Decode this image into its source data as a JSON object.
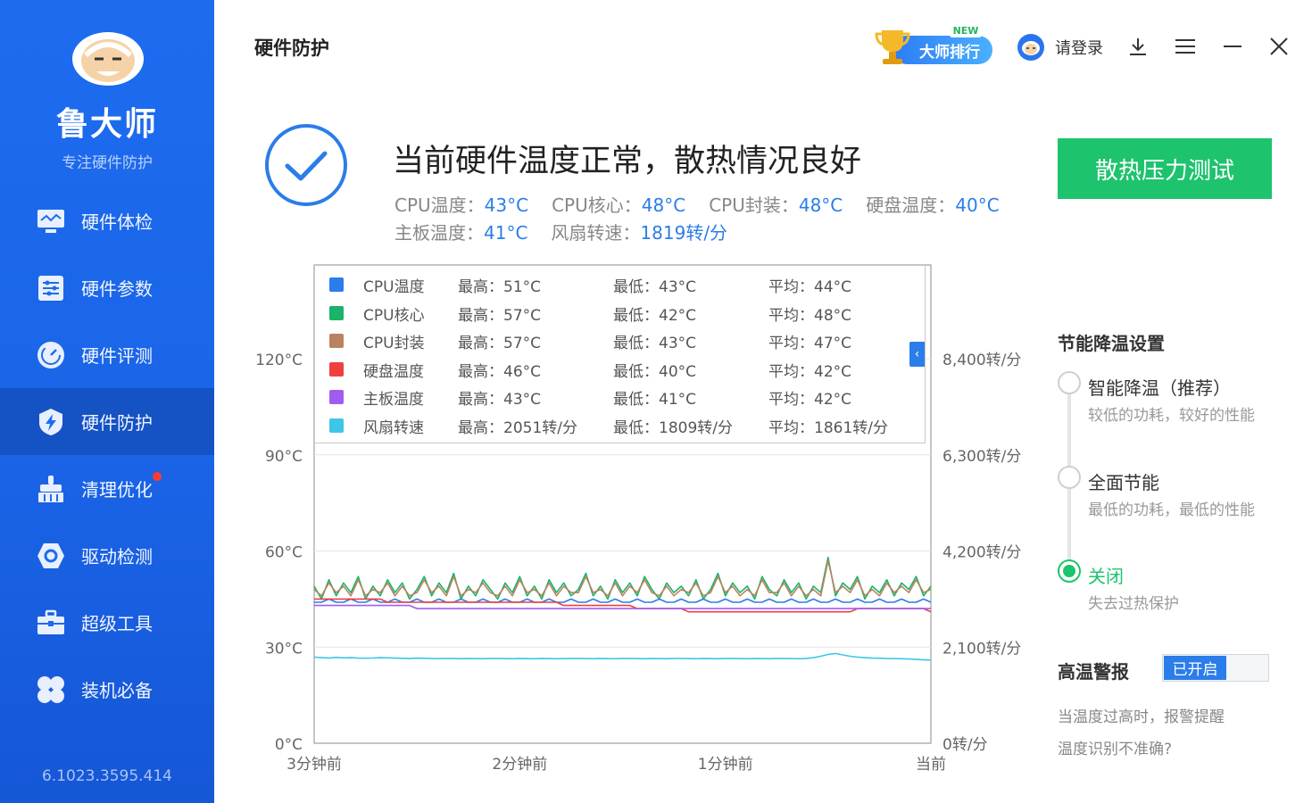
{
  "sidebar": {
    "app_name": "鲁大师",
    "slogan": "专注硬件防护",
    "version": "6.1023.3595.414",
    "items": [
      {
        "label": "硬件体检",
        "icon": "monitor-icon"
      },
      {
        "label": "硬件参数",
        "icon": "sliders-icon"
      },
      {
        "label": "硬件评测",
        "icon": "gauge-icon"
      },
      {
        "label": "硬件防护",
        "icon": "shield-bolt-icon",
        "active": true
      },
      {
        "label": "清理优化",
        "icon": "broom-icon",
        "badge": "red-dot"
      },
      {
        "label": "驱动检测",
        "icon": "hexagon-nut-icon"
      },
      {
        "label": "超级工具",
        "icon": "toolbox-icon"
      },
      {
        "label": "装机必备",
        "icon": "petals-icon"
      }
    ]
  },
  "header": {
    "title": "硬件防护",
    "rank_label": "大师排行",
    "new_tag": "NEW",
    "login_label": "请登录"
  },
  "status": {
    "headline": "当前硬件温度正常，散热情况良好",
    "metrics_row1": [
      {
        "label": "CPU温度：",
        "value": "43°C"
      },
      {
        "label": "CPU核心：",
        "value": "48°C"
      },
      {
        "label": "CPU封装：",
        "value": "48°C"
      },
      {
        "label": "硬盘温度：",
        "value": "40°C"
      }
    ],
    "metrics_row2": [
      {
        "label": "主板温度：",
        "value": "41°C"
      },
      {
        "label": "风扇转速：",
        "value": "1819转/分"
      }
    ],
    "stress_button": "散热压力测试"
  },
  "legend": [
    {
      "name": "CPU温度",
      "max": "最高：51°C",
      "min": "最低：43°C",
      "avg": "平均：44°C",
      "color": "#2b7de9"
    },
    {
      "name": "CPU核心",
      "max": "最高：57°C",
      "min": "最低：42°C",
      "avg": "平均：48°C",
      "color": "#1ab36a"
    },
    {
      "name": "CPU封装",
      "max": "最高：57°C",
      "min": "最低：43°C",
      "avg": "平均：47°C",
      "color": "#b9835f"
    },
    {
      "name": "硬盘温度",
      "max": "最高：46°C",
      "min": "最低：40°C",
      "avg": "平均：42°C",
      "color": "#ef3f3f"
    },
    {
      "name": "主板温度",
      "max": "最高：43°C",
      "min": "最低：41°C",
      "avg": "平均：42°C",
      "color": "#a05cf0"
    },
    {
      "name": "风扇转速",
      "max": "最高：2051转/分",
      "min": "最低：1809转/分",
      "avg": "平均：1861转/分",
      "color": "#3dc6e6"
    }
  ],
  "chart_data": {
    "type": "line",
    "x_tick_labels": [
      "3分钟前",
      "2分钟前",
      "1分钟前",
      "当前"
    ],
    "y_left_ticks": [
      "0°C",
      "30°C",
      "60°C",
      "90°C",
      "120°C"
    ],
    "y_right_ticks": [
      "0转/分",
      "2,100转/分",
      "4,200转/分",
      "6,300转/分",
      "8,400转/分"
    ],
    "y_left_range": [
      0,
      120
    ],
    "y_right_range": [
      0,
      8400
    ],
    "grid": true,
    "series": [
      {
        "name": "CPU核心",
        "axis": "left",
        "color": "#1ab36a",
        "values": [
          49,
          45,
          51,
          46,
          50,
          47,
          52,
          45,
          49,
          46,
          51,
          47,
          50,
          45,
          48,
          52,
          46,
          50,
          47,
          53,
          45,
          49,
          46,
          51,
          48,
          45,
          50,
          47,
          52,
          46,
          49,
          45,
          51,
          47,
          50,
          46,
          48,
          53,
          46,
          49,
          45,
          51,
          47,
          50,
          46,
          52,
          48,
          45,
          50,
          47,
          49,
          46,
          51,
          45,
          48,
          53,
          46,
          50,
          47,
          49,
          45,
          52,
          48,
          46,
          51,
          47,
          50,
          45,
          49,
          47,
          58,
          46,
          50,
          48,
          52,
          45,
          49,
          47,
          51,
          46,
          50,
          48,
          52,
          46,
          49
        ]
      },
      {
        "name": "CPU封装",
        "axis": "left",
        "color": "#b9835f",
        "values": [
          48,
          46,
          50,
          47,
          49,
          46,
          51,
          46,
          48,
          47,
          50,
          46,
          49,
          46,
          47,
          51,
          47,
          49,
          46,
          52,
          46,
          48,
          47,
          50,
          47,
          46,
          49,
          46,
          51,
          47,
          48,
          46,
          50,
          46,
          49,
          47,
          47,
          52,
          47,
          48,
          46,
          50,
          46,
          49,
          47,
          51,
          47,
          46,
          49,
          46,
          48,
          47,
          50,
          46,
          47,
          52,
          47,
          49,
          46,
          48,
          46,
          51,
          47,
          47,
          50,
          46,
          49,
          46,
          48,
          46,
          57,
          47,
          49,
          47,
          51,
          46,
          48,
          46,
          50,
          47,
          49,
          47,
          51,
          47,
          48
        ]
      },
      {
        "name": "CPU温度",
        "axis": "left",
        "color": "#2b7de9",
        "values": [
          44,
          44,
          45,
          44,
          44,
          45,
          44,
          44,
          45,
          44,
          44,
          45,
          44,
          44,
          45,
          44,
          44,
          45,
          44,
          44,
          45,
          44,
          44,
          45,
          44,
          44,
          45,
          44,
          44,
          45,
          44,
          44,
          45,
          44,
          44,
          45,
          44,
          44,
          45,
          44,
          44,
          45,
          44,
          44,
          45,
          44,
          44,
          45,
          44,
          44,
          45,
          44,
          44,
          45,
          44,
          44,
          45,
          44,
          44,
          45,
          44,
          44,
          45,
          44,
          44,
          45,
          44,
          44,
          45,
          44,
          44,
          45,
          44,
          44,
          45,
          44,
          44,
          45,
          44,
          44,
          45,
          44,
          44,
          45,
          44
        ]
      },
      {
        "name": "硬盘温度",
        "axis": "left",
        "color": "#ef3f3f",
        "values": [
          45,
          45,
          45,
          45,
          45,
          45,
          45,
          45,
          45,
          45,
          44,
          44,
          44,
          44,
          44,
          44,
          44,
          44,
          44,
          44,
          44,
          44,
          44,
          44,
          44,
          44,
          44,
          44,
          44,
          44,
          44,
          44,
          44,
          44,
          43,
          43,
          43,
          43,
          43,
          43,
          43,
          43,
          43,
          43,
          42,
          42,
          42,
          42,
          42,
          42,
          42,
          41,
          41,
          41,
          41,
          41,
          41,
          41,
          41,
          41,
          41,
          41,
          41,
          41,
          41,
          41,
          41,
          41,
          41,
          41,
          41,
          41,
          41,
          41,
          42,
          42,
          42,
          42,
          42,
          42,
          42,
          42,
          42,
          42,
          41
        ]
      },
      {
        "name": "主板温度",
        "axis": "left",
        "color": "#a05cf0",
        "values": [
          43,
          43,
          43,
          43,
          43,
          43,
          43,
          43,
          43,
          43,
          43,
          43,
          43,
          43,
          42,
          42,
          42,
          42,
          42,
          42,
          42,
          42,
          42,
          42,
          42,
          42,
          42,
          42,
          42,
          42,
          42,
          42,
          42,
          42,
          42,
          42,
          42,
          42,
          42,
          42,
          42,
          42,
          42,
          42,
          42,
          42,
          42,
          42,
          42,
          42,
          42,
          42,
          42,
          42,
          42,
          42,
          42,
          42,
          42,
          42,
          42,
          42,
          42,
          42,
          42,
          42,
          42,
          42,
          42,
          42,
          42,
          42,
          42,
          42,
          42,
          42,
          42,
          42,
          42,
          42,
          42,
          42,
          42,
          42,
          42
        ]
      },
      {
        "name": "风扇转速",
        "axis": "right",
        "color": "#3dc6e6",
        "values": [
          1880,
          1870,
          1860,
          1875,
          1865,
          1870,
          1860,
          1858,
          1862,
          1870,
          1865,
          1860,
          1855,
          1850,
          1860,
          1855,
          1850,
          1848,
          1852,
          1850,
          1845,
          1850,
          1848,
          1845,
          1850,
          1852,
          1848,
          1845,
          1850,
          1848,
          1846,
          1850,
          1848,
          1845,
          1848,
          1850,
          1852,
          1848,
          1845,
          1850,
          1848,
          1845,
          1850,
          1852,
          1848,
          1845,
          1850,
          1848,
          1846,
          1850,
          1852,
          1848,
          1845,
          1850,
          1848,
          1845,
          1850,
          1852,
          1848,
          1845,
          1850,
          1848,
          1846,
          1850,
          1852,
          1848,
          1845,
          1850,
          1870,
          1900,
          1940,
          1960,
          1930,
          1900,
          1880,
          1870,
          1860,
          1858,
          1850,
          1848,
          1845,
          1840,
          1830,
          1820,
          1819
        ]
      }
    ]
  },
  "energy": {
    "title": "节能降温设置",
    "options": [
      {
        "label": "智能降温（推荐）",
        "desc": "较低的功耗，较好的性能",
        "selected": false
      },
      {
        "label": "全面节能",
        "desc": "最低的功耗，最低的性能",
        "selected": false
      },
      {
        "label": "关闭",
        "desc": "失去过热保护",
        "selected": true
      }
    ]
  },
  "alarm": {
    "title": "高温警报",
    "toggle_label": "已开启",
    "note": "当温度过高时，报警提醒",
    "link": "温度识别不准确?"
  }
}
